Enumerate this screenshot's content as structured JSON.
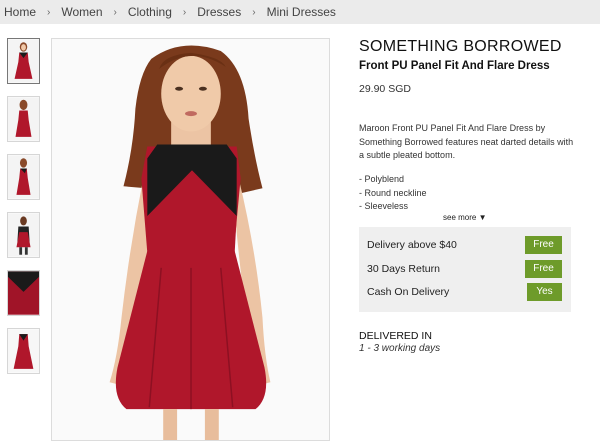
{
  "breadcrumb": {
    "items": [
      "Home",
      "Women",
      "Clothing",
      "Dresses",
      "Mini Dresses"
    ],
    "separator": "›"
  },
  "gallery": {
    "thumbnails": [
      "thumb-front",
      "thumb-back",
      "thumb-side",
      "thumb-styled",
      "thumb-detail",
      "thumb-flat"
    ],
    "active_index": 0
  },
  "product": {
    "brand": "SOMETHING BORROWED",
    "name": "Front PU Panel Fit And Flare Dress",
    "price": "29.90 SGD",
    "description": "Maroon Front PU Panel Fit And Flare Dress by Something Borrowed features neat darted details with a subtle pleated bottom.",
    "features": [
      "- Polyblend",
      "- Round neckline",
      "- Sleeveless"
    ],
    "see_more": "see more",
    "dress_color": "#b0172b",
    "panel_color": "#1a1a1a"
  },
  "perks": [
    {
      "label": "Delivery above $40",
      "value": "Free"
    },
    {
      "label": "30 Days Return",
      "value": "Free"
    },
    {
      "label": "Cash On Delivery",
      "value": "Yes"
    }
  ],
  "delivery": {
    "title": "DELIVERED IN",
    "days": "1 - 3 working days"
  },
  "colors": {
    "badge_green": "#6e9b2a",
    "breadcrumb_bg": "#ebebeb",
    "perks_bg": "#efefef"
  }
}
